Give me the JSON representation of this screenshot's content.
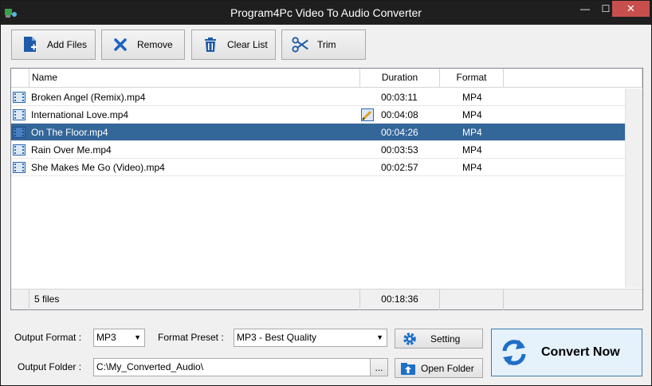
{
  "window": {
    "title": "Program4Pc Video To Audio Converter",
    "min": "—",
    "max": "☐",
    "close": "✕"
  },
  "toolbar": {
    "add_files": "Add Files",
    "remove": "Remove",
    "clear_list": "Clear List",
    "trim": "Trim"
  },
  "list": {
    "columns": {
      "name": "Name",
      "duration": "Duration",
      "format": "Format"
    },
    "files": [
      {
        "name": "Broken Angel (Remix).mp4",
        "duration": "00:03:11",
        "format": "MP4"
      },
      {
        "name": "International Love.mp4",
        "duration": "00:04:08",
        "format": "MP4"
      },
      {
        "name": "On The Floor.mp4",
        "duration": "00:04:26",
        "format": "MP4"
      },
      {
        "name": "Rain Over Me.mp4",
        "duration": "00:03:53",
        "format": "MP4"
      },
      {
        "name": "She Makes Me Go (Video).mp4",
        "duration": "00:02:57",
        "format": "MP4"
      }
    ],
    "footer": {
      "count": "5 files",
      "total": "00:18:36"
    }
  },
  "output": {
    "format_label": "Output Format :",
    "format_value": "MP3",
    "preset_label": "Format Preset :",
    "preset_value": "MP3 - Best Quality",
    "setting": "Setting",
    "folder_label": "Output Folder :",
    "folder_value": "C:\\My_Converted_Audio\\",
    "browse": "...",
    "open_folder": "Open Folder",
    "convert": "Convert Now"
  },
  "colors": {
    "selection": "#336699",
    "accent": "#1e6fc7"
  }
}
